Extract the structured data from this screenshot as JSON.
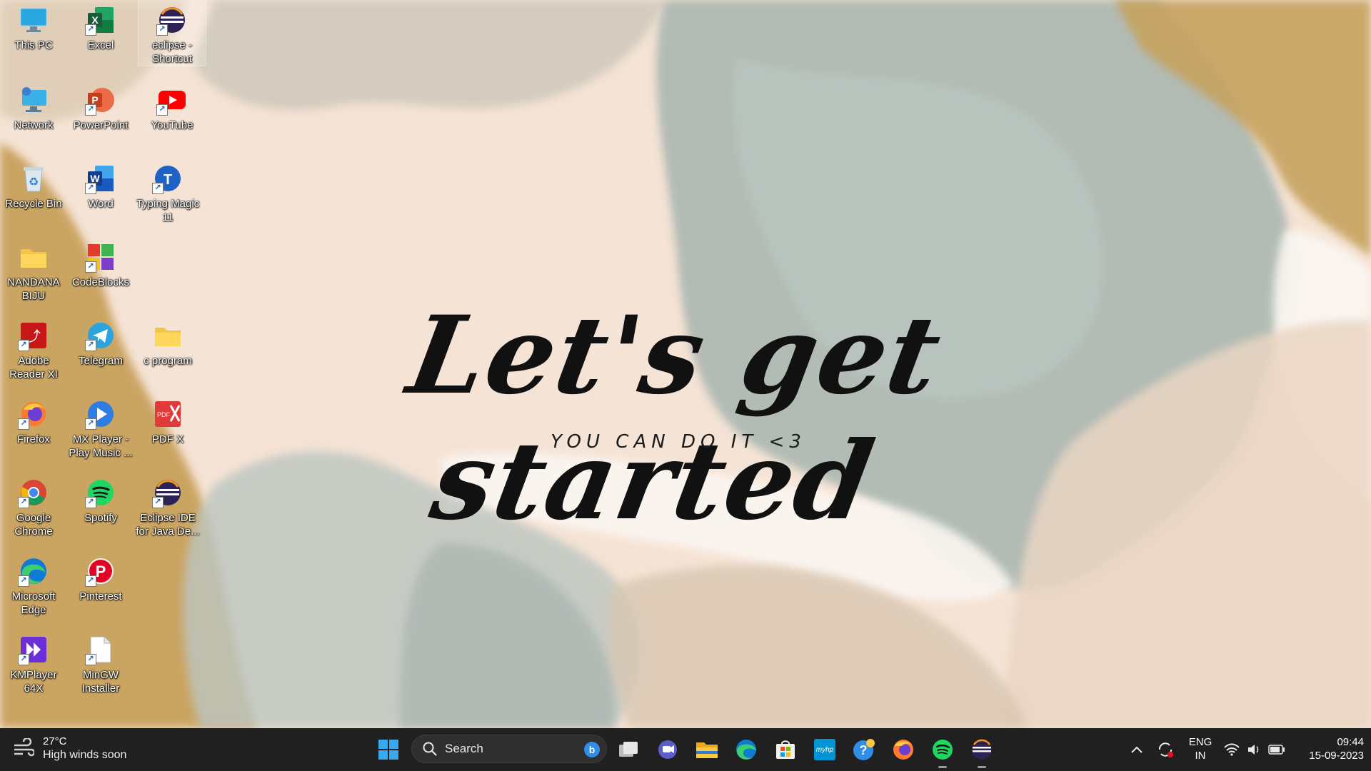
{
  "wallpaper": {
    "headline": "Let's get started",
    "subline": "YOU CAN DO IT <3"
  },
  "desktop_icons": [
    {
      "label": "This PC",
      "icon": "monitor-icon"
    },
    {
      "label": "Excel",
      "icon": "excel-icon"
    },
    {
      "label": "eclipse - Shortcut",
      "icon": "eclipse-icon"
    },
    {
      "label": "Network",
      "icon": "network-icon"
    },
    {
      "label": "PowerPoint",
      "icon": "powerpoint-icon"
    },
    {
      "label": "YouTube",
      "icon": "youtube-icon"
    },
    {
      "label": "Recycle Bin",
      "icon": "recycle-bin-icon"
    },
    {
      "label": "Word",
      "icon": "word-icon"
    },
    {
      "label": "Typing Magic 11",
      "icon": "typing-magic-icon"
    },
    {
      "label": "NANDANA BIJU",
      "icon": "folder-icon"
    },
    {
      "label": "CodeBlocks",
      "icon": "codeblocks-icon"
    },
    {
      "label": "Adobe Reader XI",
      "icon": "adobe-reader-icon"
    },
    {
      "label": "Telegram",
      "icon": "telegram-icon"
    },
    {
      "label": "c program",
      "icon": "folder-icon"
    },
    {
      "label": "Firefox",
      "icon": "firefox-icon"
    },
    {
      "label": "MX Player - Play Music ...",
      "icon": "mx-player-icon"
    },
    {
      "label": "PDF X",
      "icon": "pdf-x-icon"
    },
    {
      "label": "Google Chrome",
      "icon": "chrome-icon"
    },
    {
      "label": "Spotify",
      "icon": "spotify-icon"
    },
    {
      "label": "Eclipse IDE for Java De...",
      "icon": "eclipse-icon"
    },
    {
      "label": "Microsoft Edge",
      "icon": "edge-icon"
    },
    {
      "label": "Pinterest",
      "icon": "pinterest-icon"
    },
    {
      "label": "KMPlayer 64X",
      "icon": "kmplayer-icon"
    },
    {
      "label": "MinGW Installer",
      "icon": "file-icon"
    }
  ],
  "taskbar": {
    "weather": {
      "temp": "27°C",
      "desc": "High winds soon",
      "icon": "wind-icon"
    },
    "search": {
      "placeholder": "Search",
      "icon": "search-icon"
    },
    "pinned": [
      {
        "name": "start",
        "icon": "windows-start-icon"
      },
      {
        "name": "task-view",
        "icon": "task-view-icon"
      },
      {
        "name": "chat",
        "icon": "chat-icon"
      },
      {
        "name": "file-explorer",
        "icon": "file-explorer-icon"
      },
      {
        "name": "edge",
        "icon": "edge-icon"
      },
      {
        "name": "store",
        "icon": "store-icon"
      },
      {
        "name": "myhp",
        "icon": "myhp-icon"
      },
      {
        "name": "get-help",
        "icon": "help-icon"
      },
      {
        "name": "firefox",
        "icon": "firefox-icon"
      },
      {
        "name": "spotify",
        "icon": "spotify-icon",
        "running": true
      },
      {
        "name": "eclipse",
        "icon": "eclipse-icon",
        "running": true
      }
    ],
    "myhp_label": "myhp",
    "tray": {
      "lang_line1": "ENG",
      "lang_line2": "IN",
      "time": "09:44",
      "date": "15-09-2023"
    }
  },
  "colors": {
    "taskbar": "#202020",
    "wallpaper_peach": "#f3dccb",
    "wallpaper_gold": "#c9a055",
    "wallpaper_slate": "#a3b0aa"
  }
}
